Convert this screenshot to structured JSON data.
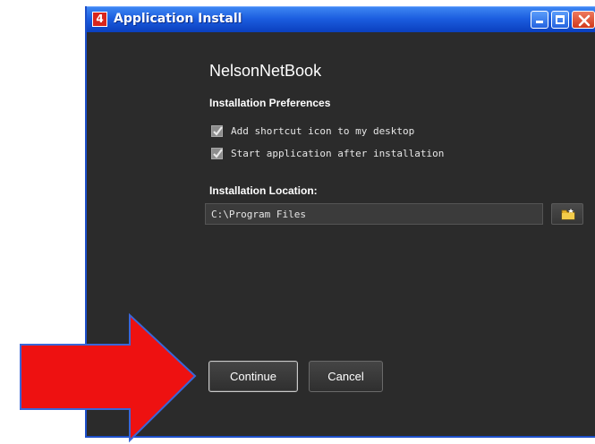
{
  "window": {
    "title": "Application Install",
    "app_icon_glyph": "4"
  },
  "installer": {
    "app_name": "NelsonNetBook",
    "preferences_heading": "Installation Preferences",
    "options": [
      {
        "label": "Add shortcut icon to my desktop",
        "checked": true
      },
      {
        "label": "Start application after installation",
        "checked": true
      }
    ],
    "location_heading": "Installation Location:",
    "location_value": "C:\\Program Files"
  },
  "buttons": {
    "continue_label": "Continue",
    "cancel_label": "Cancel"
  },
  "annotation": {
    "arrow_color": "#ee1111",
    "arrow_outline": "#3a66d8"
  },
  "icons": [
    "close-icon",
    "minimize-icon",
    "maximize-icon",
    "folder-icon",
    "checkmark-icon",
    "app-icon"
  ]
}
